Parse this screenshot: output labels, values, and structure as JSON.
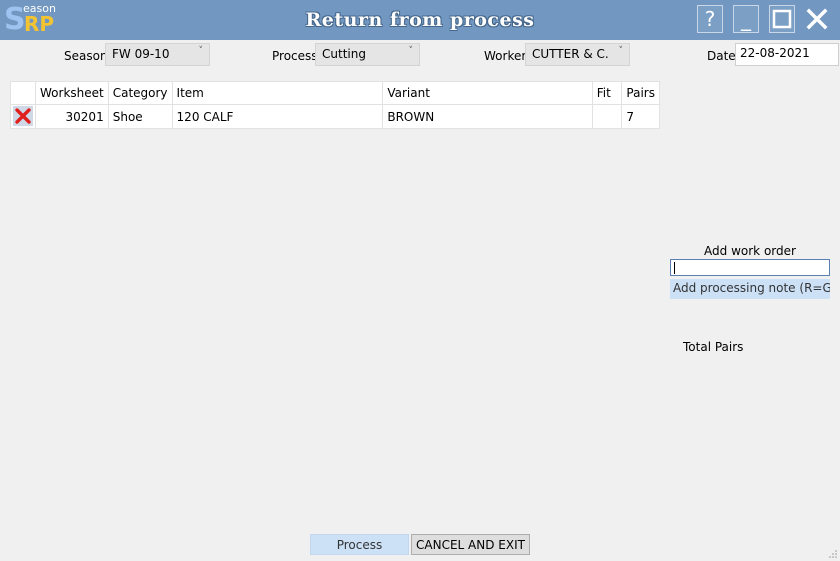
{
  "titlebar": {
    "logo_big": "S",
    "logo_small": "eason",
    "logo_rp": "RP",
    "title": "Return from process",
    "help_label": "?",
    "minimize_label": "_"
  },
  "filters": {
    "season_label": "Season",
    "season_value": "FW 09-10",
    "process_label": "Process",
    "process_value": "Cutting",
    "worker_label": "Worker",
    "worker_value": "CUTTER & C.",
    "date_label": "Date",
    "date_value": "22-08-2021"
  },
  "table": {
    "headers": [
      "",
      "Worksheet",
      "Category",
      "Item",
      "Variant",
      "Fit",
      "Pairs"
    ],
    "rows": [
      {
        "worksheet": "30201",
        "category": "Shoe",
        "item": "120 CALF",
        "variant": "BROWN",
        "fit": "",
        "pairs": "7"
      }
    ]
  },
  "side": {
    "add_work_order_label": "Add work order",
    "work_order_value": "",
    "processing_note_label": "Add processing note (R=Grou",
    "total_pairs_label": "Total Pairs"
  },
  "footer": {
    "process_label": "Process",
    "cancel_label": "CANCEL AND EXIT"
  },
  "colors": {
    "titlebar": "#7298c1",
    "accent_button": "#cce0f6",
    "delete_red": "#e0201c"
  }
}
